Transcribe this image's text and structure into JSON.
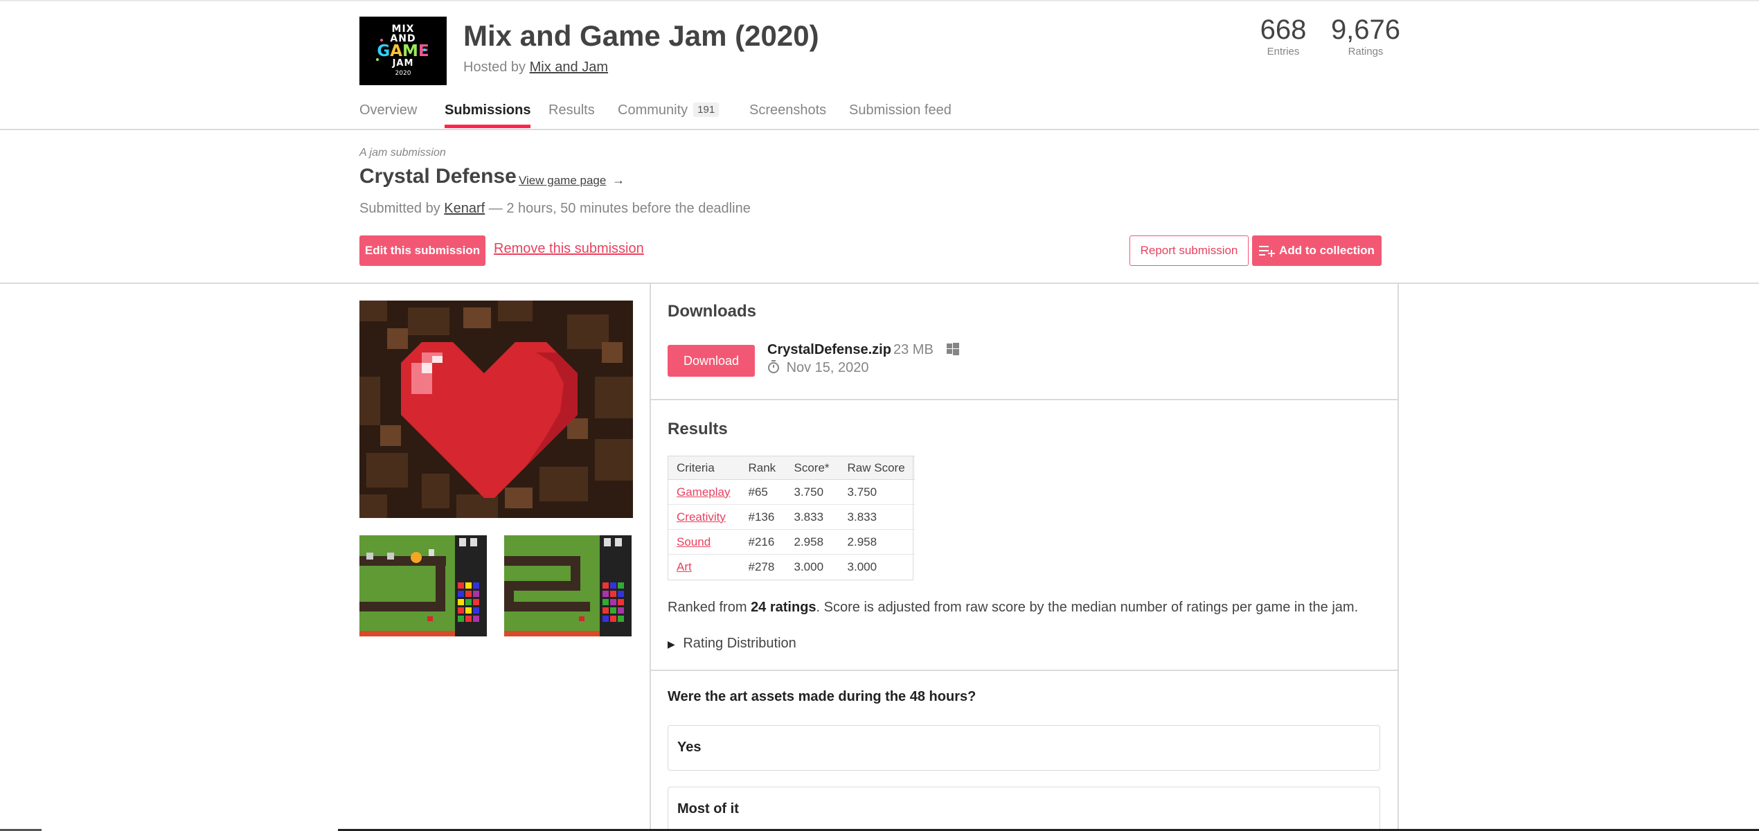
{
  "jam": {
    "logo": {
      "line1": "MIX",
      "line2": "AND",
      "game_g": "G",
      "game_a": "A",
      "game_m": "M",
      "game_e": "E",
      "line4": "JAM",
      "year": "2020"
    },
    "title": "Mix and Game Jam (2020)",
    "hosted_by_prefix": "Hosted by",
    "host": "Mix and Jam",
    "stats": [
      {
        "value": "668",
        "label": "Entries"
      },
      {
        "value": "9,676",
        "label": "Ratings"
      }
    ],
    "tabs": [
      {
        "label": "Overview",
        "active": false
      },
      {
        "label": "Submissions",
        "active": true
      },
      {
        "label": "Results",
        "active": false
      },
      {
        "label": "Community",
        "count": "191",
        "active": false
      },
      {
        "label": "Screenshots",
        "active": false
      },
      {
        "label": "Submission feed",
        "active": false
      }
    ]
  },
  "submission": {
    "label": "A jam submission",
    "game_title": "Crystal Defense",
    "view_game_page": "View game page",
    "view_game_arrow": "→",
    "submitted_prefix": "Submitted by",
    "author": "Kenarf",
    "submitted_suffix": "— 2 hours, 50 minutes before the deadline",
    "edit_button": "Edit this submission",
    "remove_link": "Remove this submission",
    "report_button": "Report submission",
    "add_collection_button": "Add to collection"
  },
  "downloads": {
    "title": "Downloads",
    "download_button": "Download",
    "file_name": "CrystalDefense.zip",
    "file_size": "23 MB",
    "platform_icon": "windows-icon",
    "date": "Nov 15, 2020",
    "date_icon": "clock-icon"
  },
  "results": {
    "title": "Results",
    "columns": [
      "Criteria",
      "Rank",
      "Score*",
      "Raw Score"
    ],
    "rows": [
      [
        "Gameplay",
        "#65",
        "3.750",
        "3.750"
      ],
      [
        "Creativity",
        "#136",
        "3.833",
        "3.833"
      ],
      [
        "Sound",
        "#216",
        "2.958",
        "2.958"
      ],
      [
        "Art",
        "#278",
        "3.000",
        "3.000"
      ]
    ],
    "ranked_prefix": "Ranked from",
    "ranked_count": "24 ratings",
    "ranked_suffix": ". Score is adjusted from raw score by the median number of ratings per game in the jam.",
    "rating_distribution": "Rating Distribution"
  },
  "questions": [
    {
      "question": "Were the art assets made during the 48 hours?",
      "answers": [
        "Yes",
        "Most of it"
      ]
    }
  ],
  "colors": {
    "accent": "#f25874",
    "tab_underline": "#ff2449",
    "link_danger": "#e8415e"
  }
}
